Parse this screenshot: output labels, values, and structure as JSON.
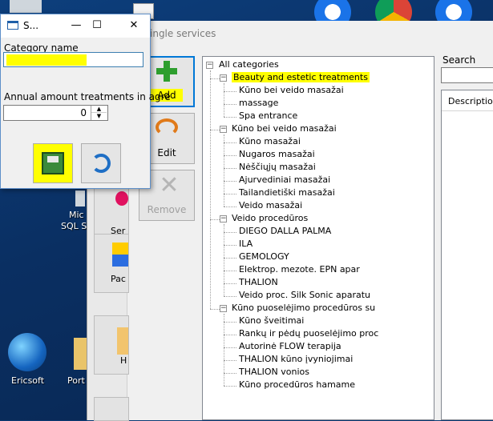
{
  "dialog": {
    "title": "S...",
    "category_label": "Category name",
    "category_value": "",
    "annual_label": "Annual amount treatments in agre",
    "annual_value": "0"
  },
  "main_window": {
    "title": "ingle services",
    "buttons": {
      "add": "Add",
      "edit": "Edit",
      "remove": "Remove"
    },
    "search_label": "Search",
    "grid_header": "Description"
  },
  "left_tiles": [
    "Ser",
    "Pac",
    "H"
  ],
  "desktop": {
    "labels": [
      "Ericsoft",
      "Port",
      "Mic",
      "SQL S"
    ]
  },
  "tree": {
    "root": "All categories",
    "groups": [
      {
        "label": "Beauty and estetic treatments",
        "highlighted": true,
        "items": [
          "Kūno bei veido masažai",
          "massage",
          "Spa entrance"
        ]
      },
      {
        "label": "Kūno bei veido masažai",
        "items": [
          "Kūno masažai",
          "Nugaros masažai",
          "Nėščiųjų masažai",
          "Ajurvediniai masažai",
          "Tailandietiški masažai",
          "Veido masažai"
        ]
      },
      {
        "label": "Veido procedūros",
        "items": [
          "DIEGO DALLA PALMA",
          "ILA",
          "GEMOLOGY",
          "Elektrop. mezote. EPN apar",
          "THALION",
          "Veido proc. Silk Sonic aparatu"
        ]
      },
      {
        "label": "Kūno puoselėjimo procedūros su",
        "items": [
          "Kūno šveitimai",
          "Rankų ir pėdų puoselėjimo proc",
          "Autorinė FLOW terapija",
          "THALION kūno įvyniojimai",
          "THALION vonios",
          "Kūno procedūros hamame"
        ]
      }
    ]
  },
  "colors": {
    "highlight": "#ffff00",
    "accent": "#0078d7",
    "add_green": "#2e9e2e",
    "desktop": "#0b3a73"
  }
}
